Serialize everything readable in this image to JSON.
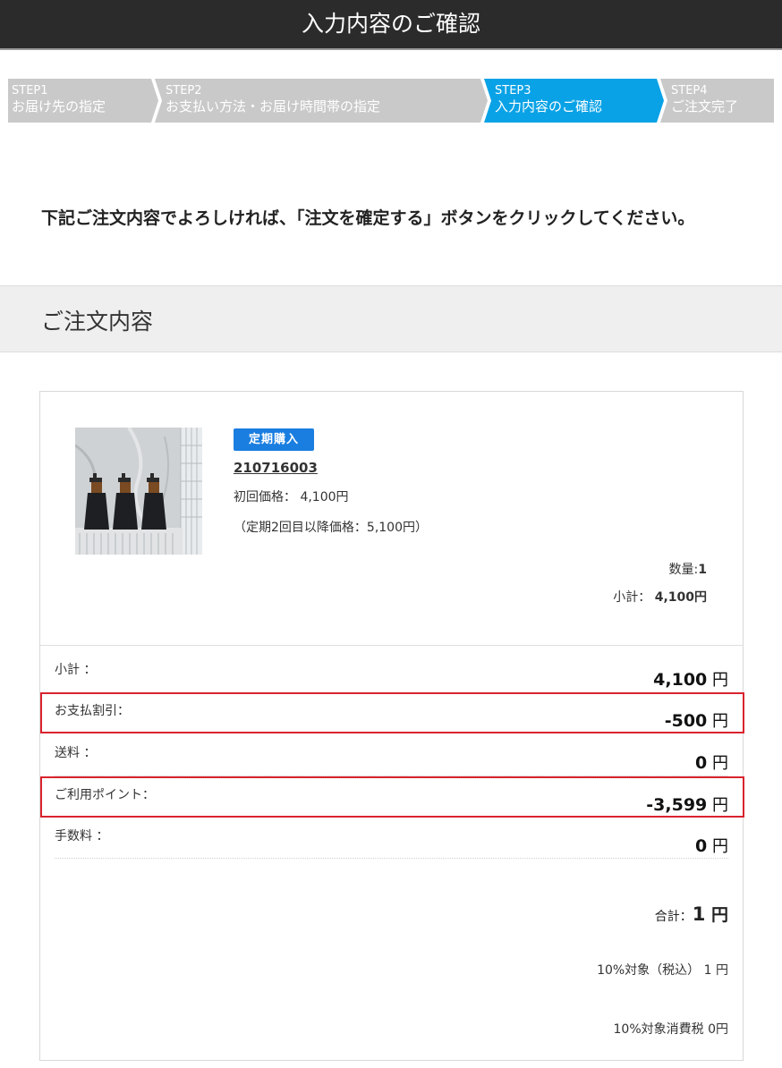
{
  "header": {
    "title": "入力内容のご確認"
  },
  "steps": [
    {
      "num": "STEP1",
      "label": "お届け先の指定",
      "active": false
    },
    {
      "num": "STEP2",
      "label": "お支払い方法・お届け時間帯の指定",
      "active": false
    },
    {
      "num": "STEP3",
      "label": "入力内容のご確認",
      "active": true
    },
    {
      "num": "STEP4",
      "label": "ご注文完了",
      "active": false
    }
  ],
  "colors": {
    "active_step": "#0aa2e6",
    "inactive_step": "#c9c9c9",
    "badge": "#1a7ee0",
    "highlight": "#d9232e"
  },
  "intro": "下記ご注文内容でよろしければ、「注文を確定する」ボタンをクリックしてください。",
  "section_title": "ご注文内容",
  "product": {
    "badge": "定期購入",
    "code": "210716003",
    "first_price": "初回価格： 4,100円",
    "later_price": "（定期2回目以降価格：5,100円）",
    "qty_label": "数量:",
    "qty_value": "1",
    "subtotal_label": "小計：",
    "subtotal_value": "4,100円"
  },
  "summary": [
    {
      "label": "小計 ：",
      "value": "4,100",
      "unit": " 円",
      "highlighted": false
    },
    {
      "label": "お支払割引：",
      "value": "-500",
      "unit": " 円",
      "highlighted": true
    },
    {
      "label": "送料 ：",
      "value": "0",
      "unit": " 円",
      "highlighted": false
    },
    {
      "label": "ご利用ポイント：",
      "value": "-3,599",
      "unit": " 円",
      "highlighted": true
    },
    {
      "label": "手数料 ：",
      "value": "0",
      "unit": " 円",
      "highlighted": false
    }
  ],
  "total": {
    "label": "合計：",
    "value": "1",
    "unit": " 円"
  },
  "tax": {
    "line1": "10%対象（税込） 1 円",
    "line2": "10%対象消費税 0円"
  }
}
